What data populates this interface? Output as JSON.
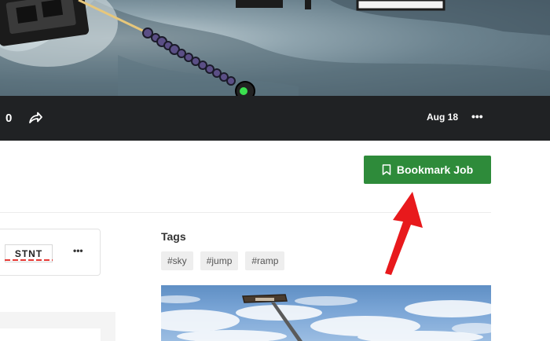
{
  "toolbar": {
    "count": "0",
    "date": "Aug 18",
    "more_icon": "•••"
  },
  "bookmark": {
    "label": "Bookmark Job"
  },
  "card": {
    "badge": "STNT",
    "more_icon": "•••"
  },
  "tags": {
    "title": "Tags",
    "items": [
      "#sky",
      "#jump",
      "#ramp"
    ]
  },
  "colors": {
    "accent_green": "#2e8b3a",
    "toolbar_bg": "#202224",
    "annotation_red": "#e8191c"
  }
}
